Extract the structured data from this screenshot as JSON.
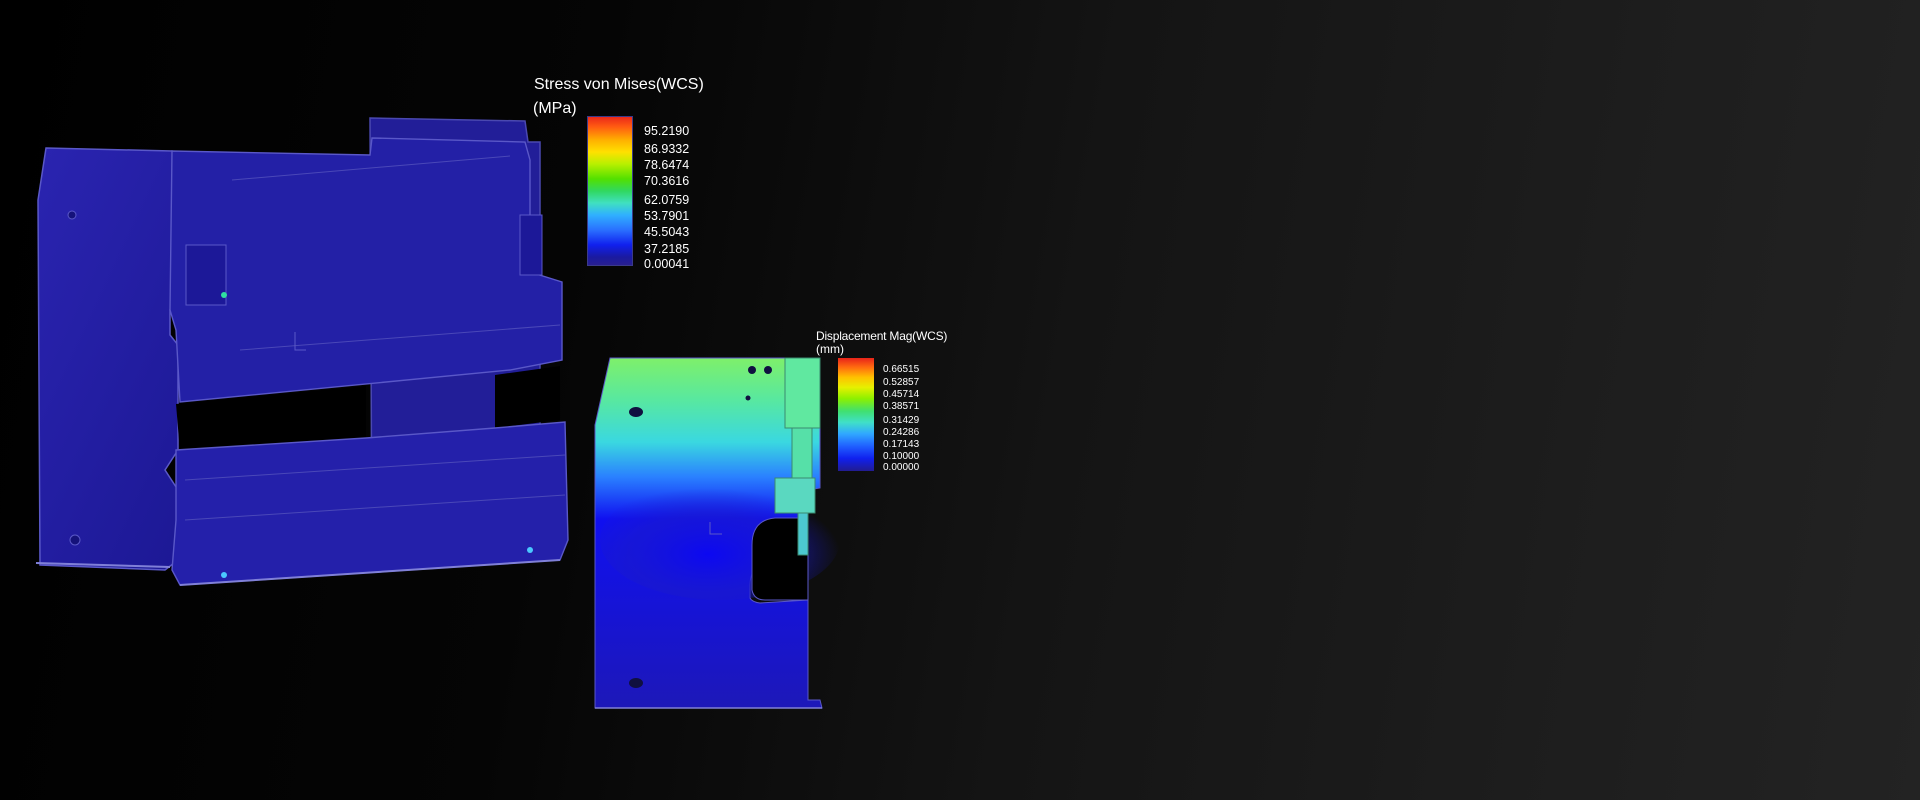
{
  "stress_legend": {
    "title": "Stress von Mises(WCS)",
    "unit": "(MPa)",
    "values": [
      "95.2190",
      "86.9332",
      "78.6474",
      "70.3616",
      "62.0759",
      "53.7901",
      "45.5043",
      "37.2185",
      "0.00041"
    ]
  },
  "displacement_legend": {
    "title": "Displacement Mag(WCS)",
    "unit": "(mm)",
    "values": [
      "0.66515",
      "0.52857",
      "0.45714",
      "0.38571",
      "0.31429",
      "0.24286",
      "0.17143",
      "0.10000",
      "0.00000"
    ]
  },
  "colors": {
    "model_blue": "#1e1aa0",
    "background_dark": "#000000",
    "background_light": "#232323"
  }
}
